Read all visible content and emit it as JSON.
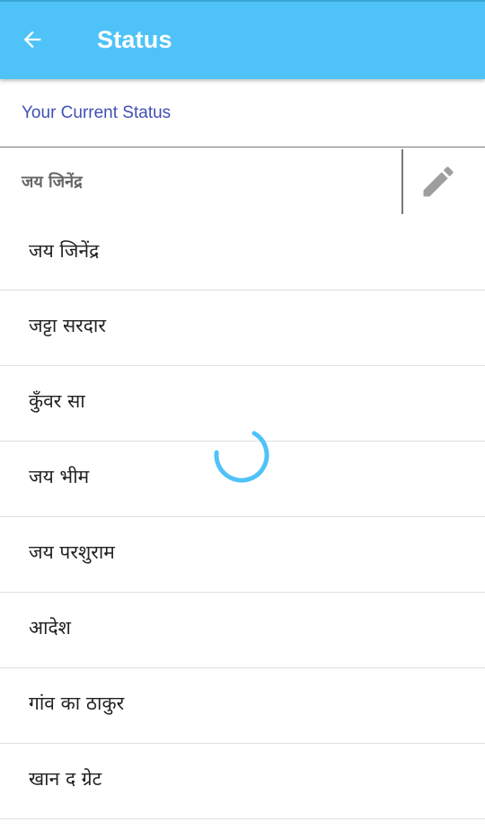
{
  "header": {
    "title": "Status",
    "back_icon": "arrow-left-icon",
    "bg_color": "#4fc3f7"
  },
  "current": {
    "label": "Your Current Status",
    "value": "जय जिनेंद्र",
    "edit_icon": "pencil-icon",
    "label_color": "#3f51b5"
  },
  "statuses": [
    {
      "label": "जय जिनेंद्र"
    },
    {
      "label": "जट्टा सरदार"
    },
    {
      "label": "कुँवर सा"
    },
    {
      "label": "जय भीम"
    },
    {
      "label": "जय परशुराम"
    },
    {
      "label": "आदेश"
    },
    {
      "label": "गांव का ठाकुर"
    },
    {
      "label": "खान द ग्रेट"
    }
  ],
  "loading": {
    "icon": "loading-spinner-icon",
    "color": "#4fc3f7"
  }
}
